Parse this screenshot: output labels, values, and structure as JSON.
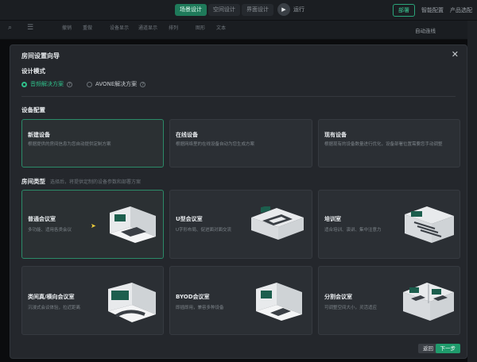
{
  "topbar": {
    "tabs": [
      "场景设计",
      "空间设计",
      "界面设计"
    ],
    "run_label": "运行",
    "deploy_label": "部署",
    "right_items": [
      "智能配置",
      "产品选配"
    ]
  },
  "toolbar": {
    "items": [
      "撤销",
      "重做",
      "设备显示",
      "通道显示",
      "排列",
      "图形",
      "文本"
    ],
    "auto_connect": "自动连线"
  },
  "modal": {
    "title": "房间设置向导",
    "design_mode": {
      "heading": "设计模式",
      "options": [
        "音频解决方案",
        "AVONE解决方案"
      ]
    },
    "device_config": {
      "heading": "设备配置",
      "cards": [
        {
          "title": "新建设备",
          "desc": "根据提供的房间信息为您自动提供定制方案"
        },
        {
          "title": "在线设备",
          "desc": "根据网络里的在线设备自动为您生成方案"
        },
        {
          "title": "现有设备",
          "desc": "根据现有的设备数量进行优化，设备部署位置需要您手动调整"
        }
      ]
    },
    "room_type": {
      "heading": "房间类型",
      "hint": "选择后，将提供定制的设备参数和部署方案",
      "cards": [
        {
          "title": "普通会议室",
          "desc": "多功能、适用各类会议"
        },
        {
          "title": "U型会议室",
          "desc": "U字形布局、促进面对面交流"
        },
        {
          "title": "培训室",
          "desc": "适合培训、演讲、集中注意力"
        },
        {
          "title": "类间真/横向会议室",
          "desc": "沉浸式会议体验，拉近距离"
        },
        {
          "title": "BYOD会议室",
          "desc": "即插即用，兼容多种设备"
        },
        {
          "title": "分割会议室",
          "desc": "可调整空间大小，灵活适应"
        }
      ]
    },
    "buttons": {
      "prev": "返回",
      "next": "下一步"
    }
  },
  "colors": {
    "accent": "#2fbf8a",
    "background": "#24272c"
  }
}
